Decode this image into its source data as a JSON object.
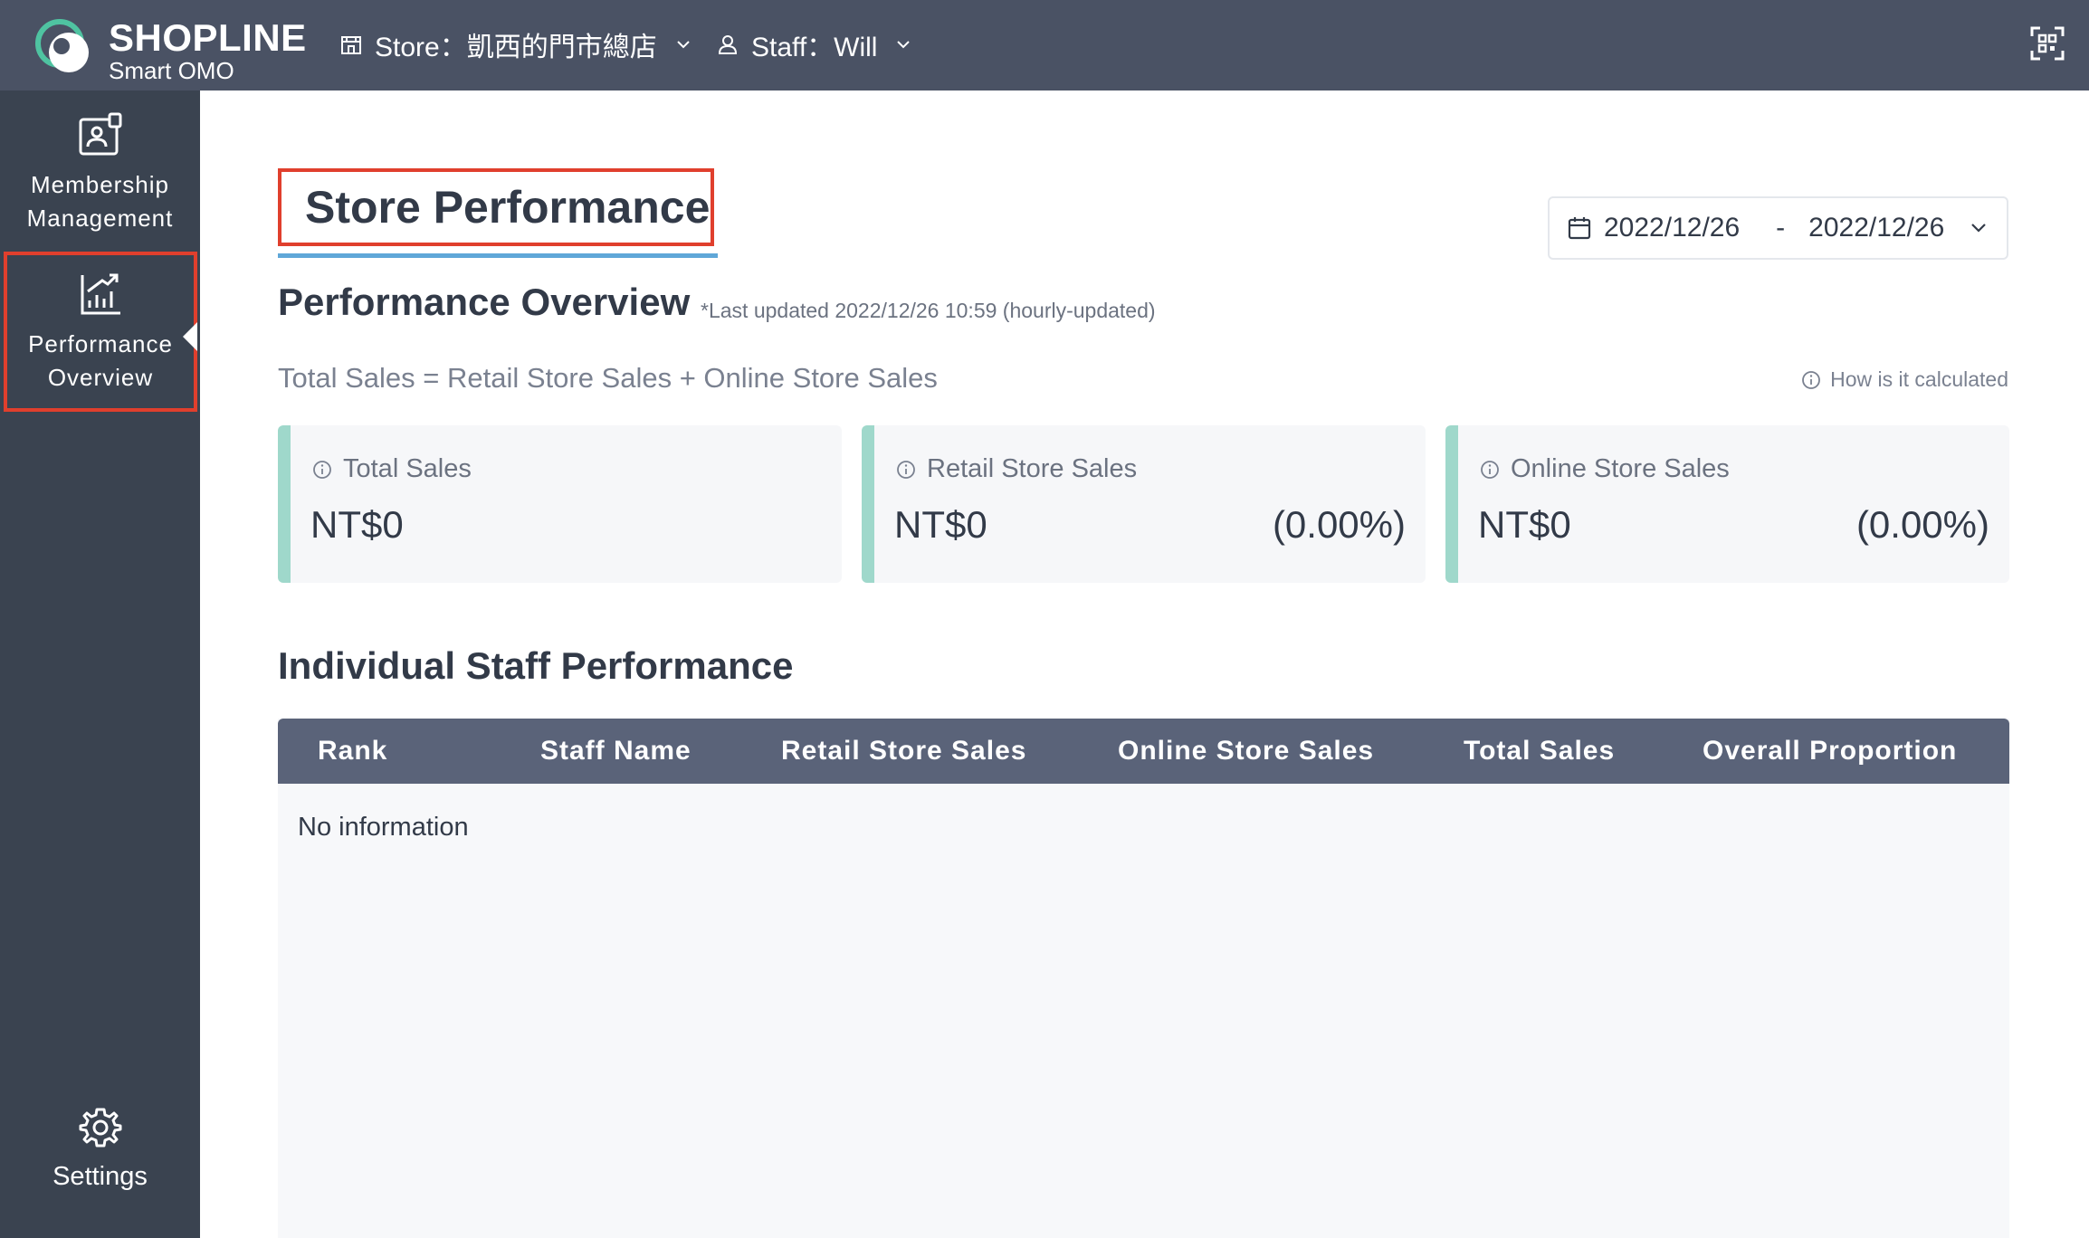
{
  "app": {
    "brand": "SHOPLINE",
    "subtitle": "Smart OMO"
  },
  "topbar": {
    "store_label": "Store：凱西的門市總店",
    "staff_label": "Staff：Will"
  },
  "sidebar": {
    "items": [
      {
        "label": "Membership\nManagement",
        "icon": "membership-card-icon"
      },
      {
        "label": "Performance\nOverview",
        "icon": "performance-chart-icon",
        "active": true
      },
      {
        "label": "Settings",
        "icon": "gear-icon"
      }
    ]
  },
  "page": {
    "title": "Store Performance",
    "date_start": "2022/12/26",
    "date_sep": "-",
    "date_end": "2022/12/26"
  },
  "overview": {
    "title": "Performance Overview",
    "last_updated": "*Last updated 2022/12/26 10:59 (hourly-updated)",
    "formula": "Total Sales = Retail Store Sales + Online Store Sales",
    "how_calculated": "How is it calculated",
    "cards": [
      {
        "label": "Total Sales",
        "value": "NT$0",
        "percent": ""
      },
      {
        "label": "Retail Store Sales",
        "value": "NT$0",
        "percent": "(0.00%)"
      },
      {
        "label": "Online Store Sales",
        "value": "NT$0",
        "percent": "(0.00%)"
      }
    ]
  },
  "staff_performance": {
    "title": "Individual Staff Performance",
    "columns": [
      "Rank",
      "Staff Name",
      "Retail Store Sales",
      "Online Store Sales",
      "Total Sales",
      "Overall Proportion"
    ],
    "rows": [],
    "empty_text": "No information"
  },
  "colors": {
    "topbar": "#4a5264",
    "sidebar": "#3a4350",
    "highlight": "#e03f2d",
    "card_accent": "#9fd8cb",
    "table_header": "#5a6379",
    "title_underline": "#5fa7d8"
  }
}
